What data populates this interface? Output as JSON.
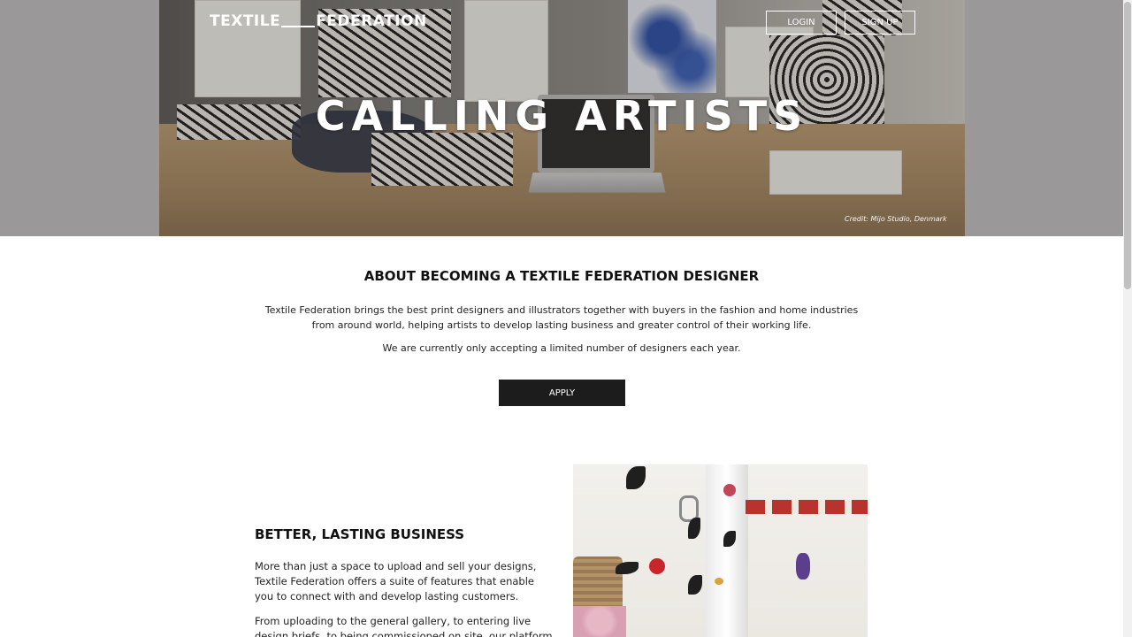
{
  "header": {
    "logo_left": "TEXTILE",
    "logo_right": "FEDERATION",
    "login_label": "LOGIN",
    "signup_label": "SIGN UP"
  },
  "hero": {
    "title": "CALLING ARTISTS",
    "credit": "Credit: Mijo Studio, Denmark"
  },
  "about": {
    "title": "ABOUT BECOMING A TEXTILE FEDERATION DESIGNER",
    "paragraph1": "Textile Federation brings the best print designers and illustrators together with buyers in the fashion and home industries from around world, helping artists to develop lasting business and greater control of their working life.",
    "paragraph2": "We are currently only accepting a limited number of designers each year.",
    "apply_label": "APPLY"
  },
  "business": {
    "title": "BETTER, LASTING BUSINESS",
    "paragraph1": "More than just a space to upload and sell your designs, Textile Federation offers a suite of features that enable you to connect with and develop lasting customers.",
    "paragraph2": "From uploading to the general gallery, to entering live design briefs, to being commissioned on site, our platform will ensure"
  },
  "colors": {
    "apply_bg": "#1c1c1c",
    "hero_text": "#ffffff"
  }
}
